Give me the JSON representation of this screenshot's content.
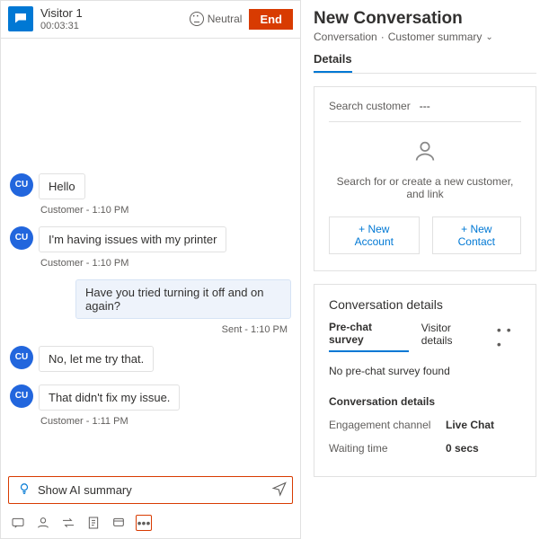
{
  "chat": {
    "visitor_name": "Visitor 1",
    "timer": "00:03:31",
    "sentiment": "Neutral",
    "end_label": "End",
    "avatar_initials": "CU",
    "messages": [
      {
        "from": "customer",
        "text": "Hello",
        "meta": "Customer - 1:10 PM"
      },
      {
        "from": "customer",
        "text": "I'm having issues with my printer",
        "meta": "Customer - 1:10 PM"
      },
      {
        "from": "agent",
        "text": "Have you tried turning it off and on again?",
        "meta": "Sent - 1:10 PM"
      },
      {
        "from": "customer",
        "text": "No, let me try that.",
        "meta": ""
      },
      {
        "from": "customer",
        "text": "That didn't fix my issue.",
        "meta": "Customer - 1:11 PM"
      }
    ],
    "composer_label": "Show AI summary"
  },
  "side": {
    "title": "New Conversation",
    "breadcrumb": {
      "item1": "Conversation",
      "item2": "Customer summary"
    },
    "tabs": {
      "details": "Details"
    },
    "customer_card": {
      "search_label": "Search customer",
      "dash": "---",
      "help_text": "Search for or create a new customer, and link",
      "new_account": "+ New Account",
      "new_contact": "+ New Contact"
    },
    "conv_card": {
      "title": "Conversation details",
      "subtabs": {
        "prechat": "Pre-chat survey",
        "visitor": "Visitor details"
      },
      "empty": "No pre-chat survey found",
      "subheader": "Conversation details",
      "rows": [
        {
          "label": "Engagement channel",
          "value": "Live Chat"
        },
        {
          "label": "Waiting time",
          "value": "0 secs"
        }
      ]
    }
  }
}
